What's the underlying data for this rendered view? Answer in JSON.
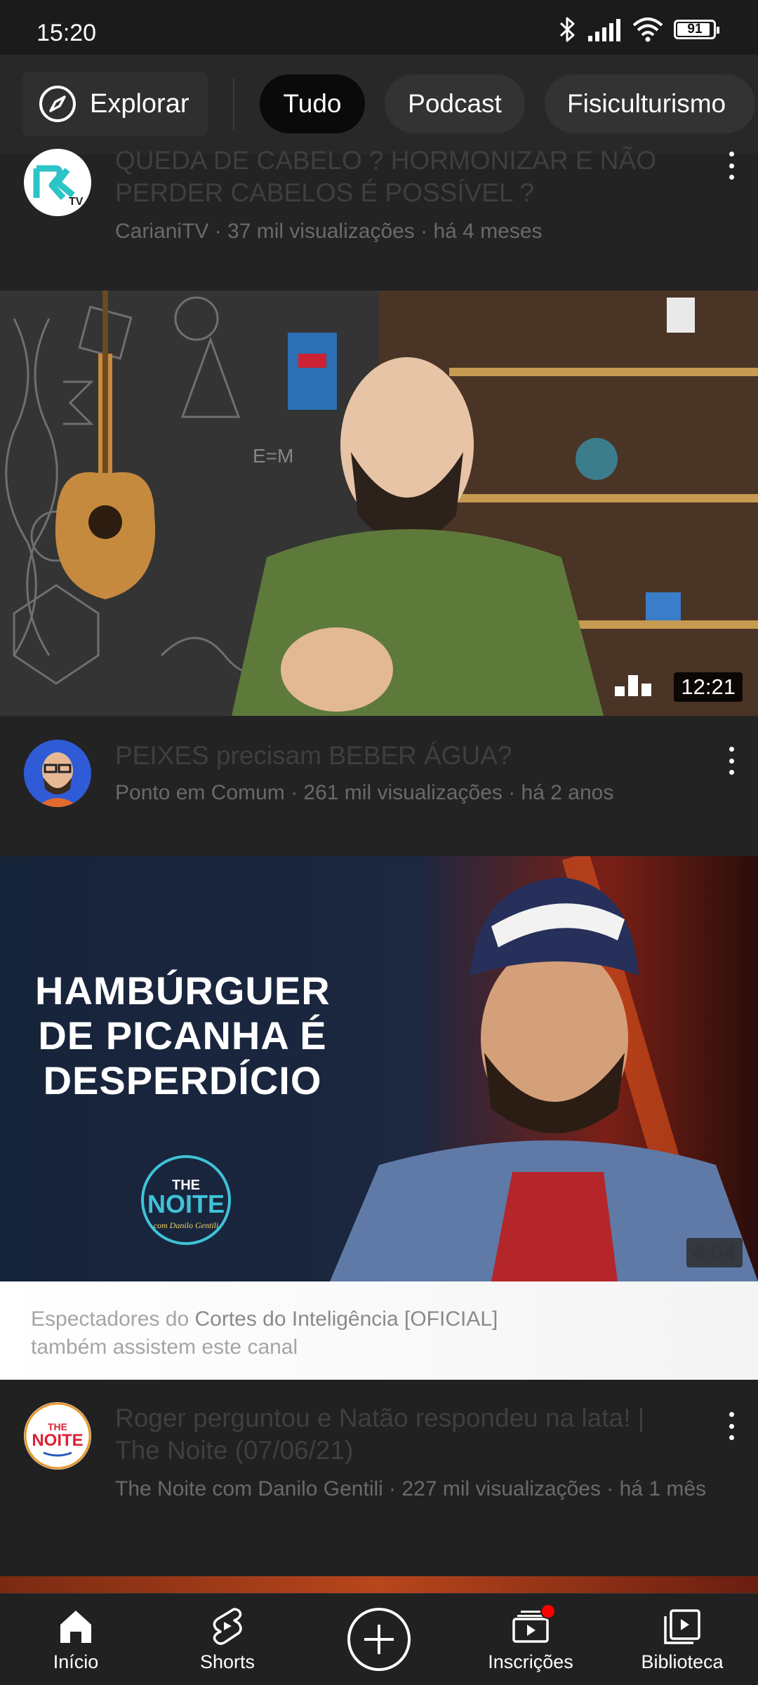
{
  "status_bar": {
    "time": "15:20",
    "battery": "91",
    "icons": [
      "bluetooth-icon",
      "signal-icon",
      "wifi-icon",
      "battery-icon"
    ]
  },
  "chips": {
    "explore_label": "Explorar",
    "items": [
      {
        "label": "Tudo",
        "selected": true
      },
      {
        "label": "Podcast",
        "selected": false
      },
      {
        "label": "Fisiculturismo",
        "selected": false
      }
    ]
  },
  "videos": [
    {
      "title": "QUEDA DE CABELO ? HORMONIZAR E NÃO PERDER CABELOS É POSSÍVEL ?",
      "meta": "CarianiTV · 37 mil visualizações · há 4 meses",
      "avatar_text": "TV"
    },
    {
      "title": "PEIXES precisam BEBER ÁGUA?",
      "meta": "Ponto em Comum · 261 mil visualizações · há 2 anos",
      "duration": "12:21"
    },
    {
      "title": "Roger perguntou e Natão respondeu na lata! | The Noite (07/06/21)",
      "meta": "The Noite com Danilo Gentili · 227 mil visualizações · há 1 mês",
      "duration": "4:04",
      "thumb_headline": [
        "HAMBÚRGUER",
        "DE PICANHA É",
        "DESPERDÍCIO"
      ],
      "thumb_logo_top": "THE",
      "thumb_logo_main": "NOITE",
      "thumb_logo_sub": "com Danilo Gentili",
      "avatar_top": "THE",
      "avatar_main": "NOITE"
    }
  ],
  "recommendation": {
    "prefix": "Espectadores do ",
    "channel": "Cortes do Inteligência [OFICIAL]",
    "suffix": "também assistem este canal"
  },
  "bottom_nav": {
    "items": [
      {
        "label": "Início",
        "icon": "home-icon",
        "active": true
      },
      {
        "label": "Shorts",
        "icon": "shorts-icon"
      },
      {
        "label": "",
        "icon": "create-icon"
      },
      {
        "label": "Inscrições",
        "icon": "subscriptions-icon",
        "badge": true
      },
      {
        "label": "Biblioteca",
        "icon": "library-icon"
      }
    ]
  }
}
